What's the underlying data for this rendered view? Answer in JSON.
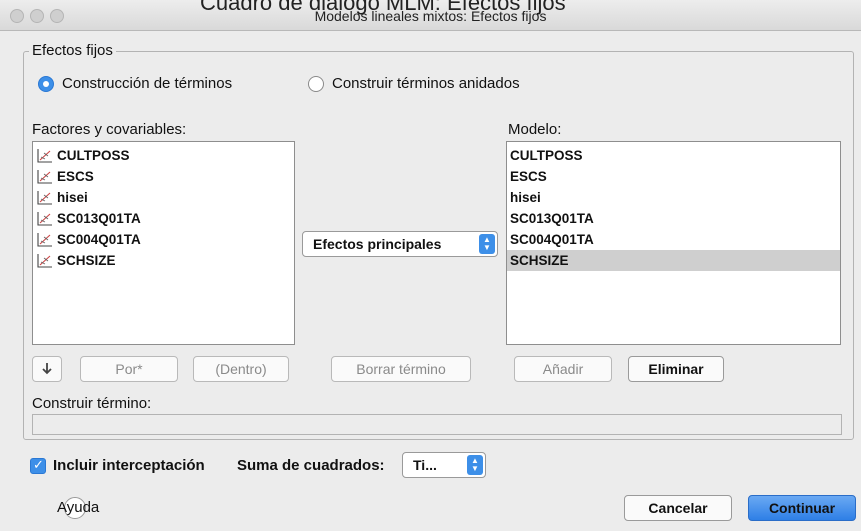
{
  "caption": "Cuadro de diálogo MLM: Efectos fijos",
  "window": {
    "title": "Modelos lineales mixtos: Efectos fijos"
  },
  "group": {
    "label": "Efectos fijos"
  },
  "radios": [
    {
      "label": "Construcción de términos",
      "checked": true
    },
    {
      "label": "Construir términos anidados",
      "checked": false
    }
  ],
  "factors": {
    "label": "Factores y covariables:",
    "items": [
      "CULTPOSS",
      "ESCS",
      "hisei",
      "SC013Q01TA",
      "SC004Q01TA",
      "SCHSIZE"
    ],
    "item_icon": "scale-variable-icon"
  },
  "model": {
    "label": "Modelo:",
    "items": [
      "CULTPOSS",
      "ESCS",
      "hisei",
      "SC013Q01TA",
      "SC004Q01TA",
      "SCHSIZE"
    ],
    "selected": "SCHSIZE"
  },
  "effect_select": {
    "value": "Efectos principales"
  },
  "buttons": {
    "down_arrow_icon": "down-arrow-icon",
    "por": "Por*",
    "dentro": "(Dentro)",
    "borrar": "Borrar término",
    "anadir": "Añadir",
    "eliminar": "Eliminar"
  },
  "build_term": {
    "label": "Construir término:",
    "value": ""
  },
  "intercept": {
    "label": "Incluir interceptación",
    "checked": true
  },
  "sum_squares": {
    "label": "Suma de cuadrados:",
    "value": "Ti..."
  },
  "footer": {
    "help": "Ayuda",
    "cancel": "Cancelar",
    "continue": "Continuar"
  },
  "colors": {
    "accent": "#3d8fe8",
    "selection": "#cfcfcf",
    "background": "#ececec"
  }
}
